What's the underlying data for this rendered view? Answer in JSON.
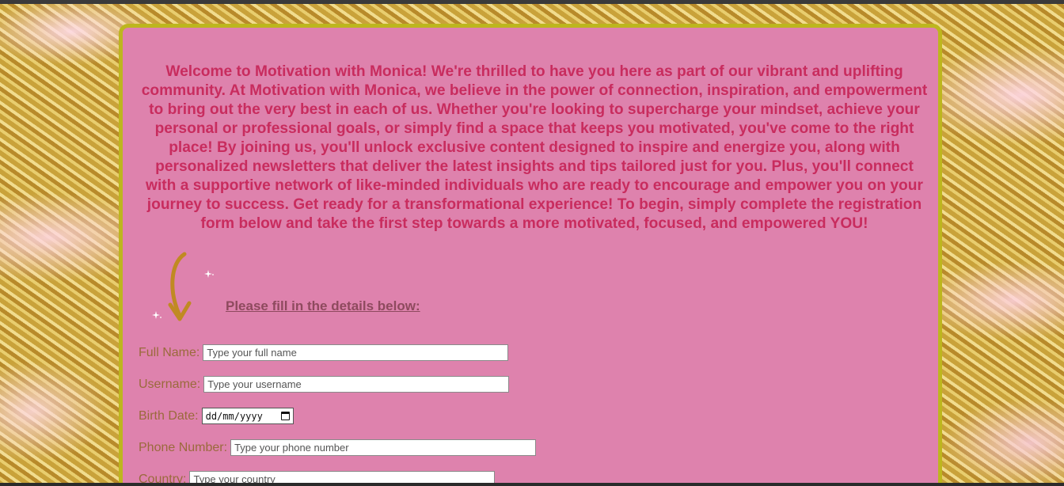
{
  "intro": {
    "text": "Welcome to Motivation with Monica! We're thrilled to have you here as part of our vibrant and uplifting community. At Motivation with Monica, we believe in the power of connection, inspiration, and empowerment to bring out the very best in each of us. Whether you're looking to supercharge your mindset, achieve your personal or professional goals, or simply find a space that keeps you motivated, you've come to the right place! By joining us, you'll unlock exclusive content designed to inspire and energize you, along with personalized newsletters that deliver the latest insights and tips tailored just for you. Plus, you'll connect with a supportive network of like-minded individuals who are ready to encourage and empower you on your journey to success. Get ready for a transformational experience! To begin, simply complete the registration form below and take the first step towards a more motivated, focused, and empowered YOU!"
  },
  "form": {
    "heading": "Please fill in the details below:",
    "full_name": {
      "label": "Full Name:",
      "placeholder": "Type your full name"
    },
    "username": {
      "label": "Username:",
      "placeholder": "Type your username"
    },
    "birth_date": {
      "label": "Birth Date:",
      "placeholder": "dd/mm/yyyy"
    },
    "phone": {
      "label": "Phone Number:",
      "placeholder": "Type your phone number"
    },
    "country": {
      "label": "Country:",
      "placeholder": "Type your country"
    }
  },
  "colors": {
    "card_background": "#de82ad",
    "card_border": "#bdb61e",
    "intro_text": "#c82c5e",
    "label_text": "#9a6a3c",
    "arrow": "#c08a22"
  },
  "icons": {
    "arrow": "curved-arrow-down-icon",
    "sparkle": "sparkle-icon",
    "calendar": "calendar-icon"
  }
}
